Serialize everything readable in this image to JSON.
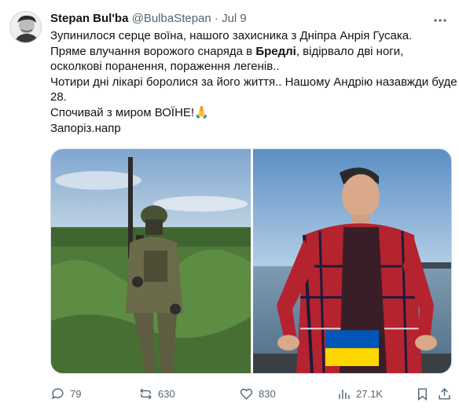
{
  "author": {
    "name": "Stepan Bul'ba",
    "handle": "@BulbaStepan",
    "separator": "·",
    "date": "Jul 9"
  },
  "tweet": {
    "line1": "Зупинилося серце воїна, нашого захисника з Дніпра Анрія Гусака.",
    "line2_a": "Пряме влучання ворожого снаряда в ",
    "line2_bold": "Бредлі",
    "line2_b": ", відірвало дві ноги,",
    "line3": "осколкові поранення, пораження легенів..",
    "line4": "Чотири дні лікарі боролися за його життя.. Нашому Андрію назавжди буде",
    "line5": "28.",
    "line6": "Спочивай з миром ВОЇНЕ!🙏",
    "line7": "Запоріз.напр"
  },
  "stats": {
    "replies": "79",
    "retweets": "630",
    "likes": "830",
    "views": "27.1K"
  },
  "icons": {
    "more": "more-icon",
    "reply": "reply-icon",
    "retweet": "retweet-icon",
    "like": "heart-icon",
    "views": "views-icon",
    "bookmark": "bookmark-icon",
    "share": "share-icon"
  },
  "colors": {
    "text": "#0f1419",
    "secondary": "#536471",
    "flag_blue": "#0057b7",
    "flag_yellow": "#ffd700"
  }
}
